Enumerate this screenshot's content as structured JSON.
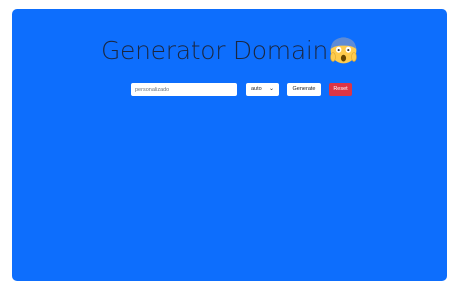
{
  "header": {
    "title": "Generator Domain",
    "emoji_icon": "face-screaming-in-fear-icon"
  },
  "form": {
    "input_placeholder": "personalizado",
    "input_value": "",
    "select_value": "auto",
    "generate_label": "Generate",
    "reset_label": "Reset"
  },
  "colors": {
    "panel_bg": "#0d6efd",
    "reset_bg": "#dc3545"
  }
}
